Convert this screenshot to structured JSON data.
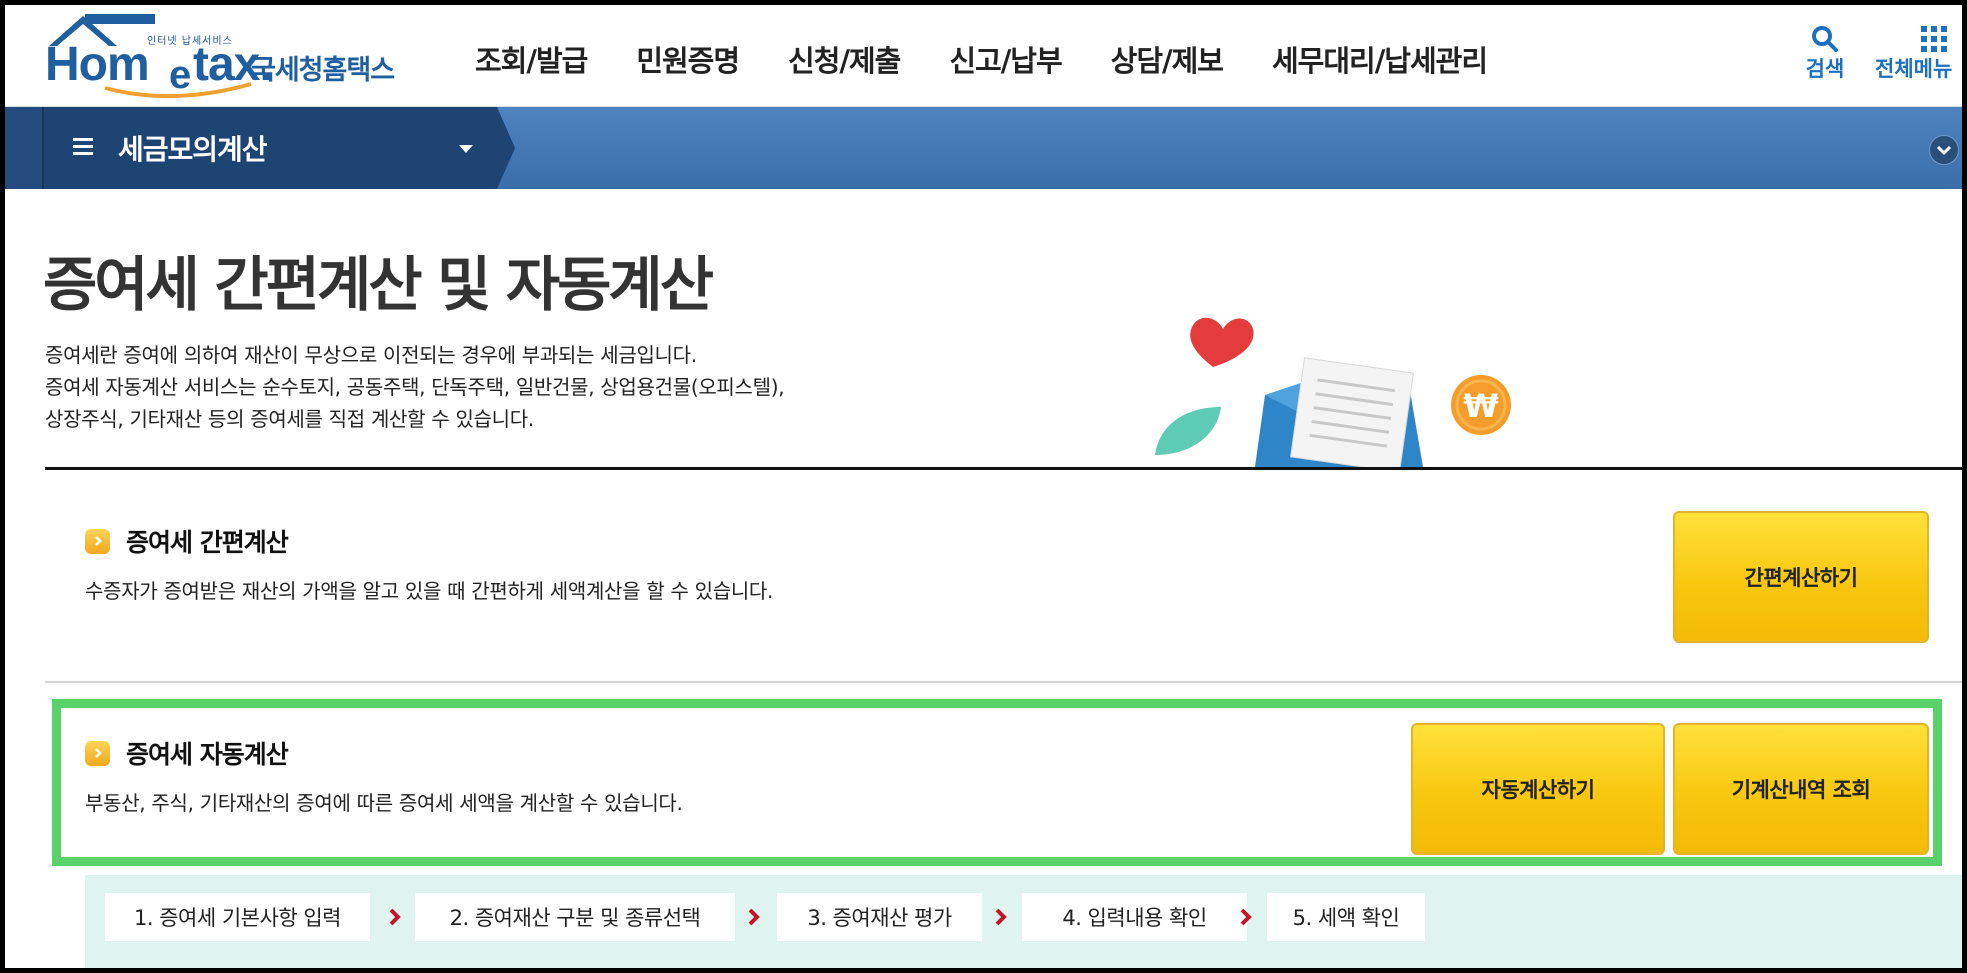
{
  "header": {
    "logo": {
      "tagline": "인터넷 납세서비스",
      "brand_home": "Hom",
      "brand_e": "e",
      "brand_tax": "tax.",
      "korean_name": "국세청홈택스"
    },
    "nav": [
      {
        "label": "조회/발급"
      },
      {
        "label": "민원증명"
      },
      {
        "label": "신청/제출"
      },
      {
        "label": "신고/납부"
      },
      {
        "label": "상담/제보"
      },
      {
        "label": "세무대리/납세관리"
      }
    ],
    "search_label": "검색",
    "all_menu_label": "전체메뉴"
  },
  "sub_nav": {
    "title": "세금모의계산"
  },
  "page": {
    "title": "증여세 간편계산 및 자동계산",
    "intro_lines": [
      "증여세란 증여에 의하여 재산이 무상으로 이전되는 경우에 부과되는 세금입니다.",
      "증여세 자동계산 서비스는 순수토지, 공동주택, 단독주택, 일반건물, 상업용건물(오피스텔),",
      "상장주식, 기타재산 등의 증여세를 직접 계산할 수 있습니다."
    ]
  },
  "simple_calc": {
    "title": "증여세 간편계산",
    "description": "수증자가 증여받은 재산의 가액을 알고 있을 때 간편하게 세액계산을 할 수 있습니다.",
    "button_label": "간편계산하기"
  },
  "auto_calc": {
    "title": "증여세 자동계산",
    "description": "부동산, 주식, 기타재산의 증여에 따른 증여세 세액을 계산할 수 있습니다.",
    "auto_button_label": "자동계산하기",
    "history_button_label": "기계산내역 조회"
  },
  "steps": [
    {
      "label": "1. 증여세 기본사항 입력"
    },
    {
      "label": "2. 증여재산 구분 및 종류선택"
    },
    {
      "label": "3. 증여재산 평가"
    },
    {
      "label": "4. 입력내용 확인"
    },
    {
      "label": "5. 세액 확인"
    }
  ],
  "colors": {
    "brand_blue": "#1f5f9f",
    "subnav_blue": "#4a7fbb",
    "subnav_dark": "#1d4473",
    "button_yellow": "#f7c50c",
    "highlight_green": "#5ad26a",
    "steps_bg": "#dff3ef",
    "step_arrow_red": "#c0162b"
  },
  "icons": {
    "search": "search-icon",
    "all_menu": "grid-icon",
    "hamburger": "hamburger-icon",
    "bullet": "chevron-right-icon"
  }
}
